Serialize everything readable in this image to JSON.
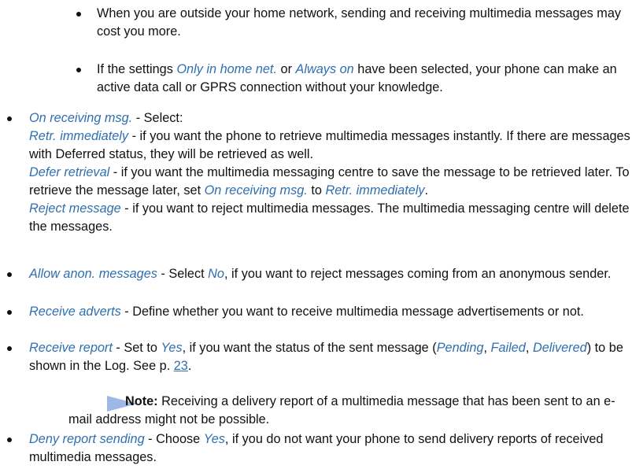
{
  "sub_bullets": [
    {
      "text": "When you are outside your home network, sending and receiving multimedia messages may cost you more."
    },
    {
      "p1": "If the settings ",
      "opt1": "Only in home net.",
      "p2": " or ",
      "opt2": "Always on",
      "p3": " have been selected, your phone can make an active data call or GPRS connection without your knowledge."
    }
  ],
  "receiving": {
    "term": "On receiving msg.",
    "intro": " - Select:",
    "opt1_term": "Retr. immediately",
    "opt1_text": " - if you want the phone to retrieve multimedia messages instantly. If there are messages with Deferred status, they will be retrieved as well.",
    "opt2_term": "Defer retrieval",
    "opt2_text": " - if you want the multimedia messaging centre to save the message to be retrieved later. To retrieve the message later, set ",
    "opt2_ref1": "On receiving msg.",
    "opt2_to": " to ",
    "opt2_ref2": "Retr. immediately",
    "opt2_end": ".",
    "opt3_term": "Reject message",
    "opt3_text": " - if you want to reject multimedia messages. The multimedia messaging centre will delete the messages."
  },
  "anon": {
    "term": "Allow anon. messages",
    "p1": " - Select ",
    "opt": "No",
    "p2": ", if you want to reject messages coming from an anonymous sender."
  },
  "adverts": {
    "term": "Receive adverts",
    "text": " - Define whether you want to receive multimedia message advertisements or not."
  },
  "report": {
    "term": "Receive report",
    "p1": " - Set to ",
    "opt": "Yes",
    "p2": ", if you want the status of the sent message (",
    "s1": "Pending",
    "c1": ", ",
    "s2": "Failed",
    "c2": ", ",
    "s3": "Delivered",
    "p3": ") to be shown in the Log. See p. ",
    "page_ref": "23",
    "end": "."
  },
  "note": {
    "label": "Note:",
    "text": " Receiving a delivery report of a multimedia message that has been sent to an e-mail address might not be possible.",
    "arrow_color": "#9db8e6"
  },
  "deny": {
    "term": "Deny report sending",
    "p1": " - Choose ",
    "opt": "Yes",
    "p2": ", if you do not want your phone to send delivery reports of received multimedia messages."
  },
  "colors": {
    "option_text": "#2f6fb0",
    "body_text": "#111111"
  }
}
